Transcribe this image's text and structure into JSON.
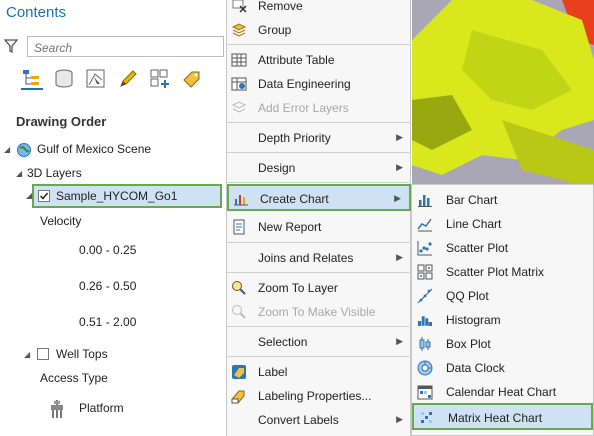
{
  "contents": {
    "title": "Contents",
    "search_placeholder": "Search",
    "toolbar_icons": [
      "list-by-drawing-order-icon",
      "list-by-source-icon",
      "list-by-selection-icon",
      "list-by-editing-icon",
      "list-by-snapping-icon",
      "list-by-labeling-icon"
    ],
    "section_heading": "Drawing Order",
    "tree": {
      "scene": "Gulf of Mexico Scene",
      "layers_group": "3D Layers",
      "selected_layer": "Sample_HYCOM_Go1",
      "velocity_label": "Velocity",
      "velocity_classes": [
        "0.00 - 0.25",
        "0.26 - 0.50",
        "0.51 - 2.00"
      ],
      "well_tops": "Well Tops",
      "access_type": "Access Type",
      "platform": "Platform"
    }
  },
  "context_menu": {
    "items": [
      {
        "label": "Remove",
        "icon": "remove-icon"
      },
      {
        "label": "Group",
        "icon": "group-icon"
      },
      {
        "label": "Attribute Table",
        "icon": "table-icon"
      },
      {
        "label": "Data Engineering",
        "icon": "data-engineering-icon"
      },
      {
        "label": "Add Error Layers",
        "icon": "error-layers-icon",
        "disabled": true
      },
      {
        "label": "Depth Priority",
        "submenu": true
      },
      {
        "label": "Design",
        "submenu": true
      },
      {
        "label": "Create Chart",
        "icon": "chart-icon",
        "submenu": true,
        "selected": true
      },
      {
        "label": "New Report",
        "icon": "report-icon"
      },
      {
        "label": "Joins and Relates",
        "submenu": true
      },
      {
        "label": "Zoom To Layer",
        "icon": "zoom-layer-icon"
      },
      {
        "label": "Zoom To Make Visible",
        "icon": "zoom-visible-icon",
        "disabled": true
      },
      {
        "label": "Selection",
        "submenu": true
      },
      {
        "label": "Label",
        "icon": "label-icon"
      },
      {
        "label": "Labeling Properties...",
        "icon": "labeling-properties-icon"
      },
      {
        "label": "Convert Labels",
        "submenu": true
      }
    ]
  },
  "chart_submenu": {
    "items": [
      {
        "label": "Bar Chart",
        "icon": "bar-chart-icon"
      },
      {
        "label": "Line Chart",
        "icon": "line-chart-icon"
      },
      {
        "label": "Scatter Plot",
        "icon": "scatter-plot-icon"
      },
      {
        "label": "Scatter Plot Matrix",
        "icon": "scatter-matrix-icon"
      },
      {
        "label": "QQ Plot",
        "icon": "qq-plot-icon"
      },
      {
        "label": "Histogram",
        "icon": "histogram-icon"
      },
      {
        "label": "Box Plot",
        "icon": "box-plot-icon"
      },
      {
        "label": "Data Clock",
        "icon": "data-clock-icon"
      },
      {
        "label": "Calendar Heat Chart",
        "icon": "calendar-heat-icon"
      },
      {
        "label": "Matrix Heat Chart",
        "icon": "matrix-heat-icon",
        "selected": true
      }
    ]
  },
  "colors": {
    "accent": "#1f6fb2",
    "highlight": "#cfe2f3",
    "highlight_border": "#6aa84f",
    "map_bg": "#a9a7b6",
    "map_yellow": "#d8e81c",
    "map_red": "#e8401c"
  }
}
